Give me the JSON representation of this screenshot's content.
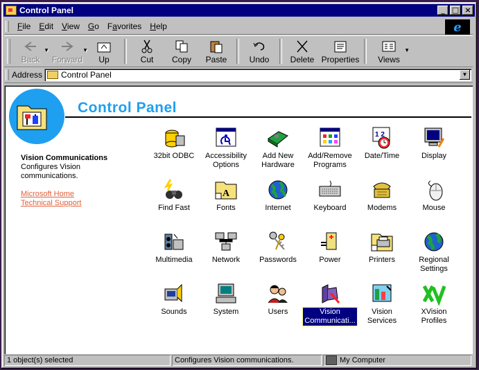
{
  "window": {
    "title": "Control Panel"
  },
  "menu": [
    "File",
    "Edit",
    "View",
    "Go",
    "Favorites",
    "Help"
  ],
  "menu_access_keys": [
    "F",
    "E",
    "V",
    "G",
    "a",
    "H"
  ],
  "toolbar": {
    "back": "Back",
    "forward": "Forward",
    "up": "Up",
    "cut": "Cut",
    "copy": "Copy",
    "paste": "Paste",
    "undo": "Undo",
    "delete": "Delete",
    "properties": "Properties",
    "views": "Views"
  },
  "address": {
    "label": "Address",
    "value": "Control Panel"
  },
  "banner": {
    "title": "Control Panel"
  },
  "info": {
    "title": "Vision Communications",
    "description": "Configures Vision communications.",
    "links": [
      "Microsoft Home",
      "Technical Support"
    ]
  },
  "items": [
    "32bit ODBC",
    "Accessibility\nOptions",
    "Add New\nHardware",
    "Add/Remove\nPrograms",
    "Date/Time",
    "Display",
    "Find Fast",
    "Fonts",
    "Internet",
    "Keyboard",
    "Modems",
    "Mouse",
    "Multimedia",
    "Network",
    "Passwords",
    "Power",
    "Printers",
    "Regional\nSettings",
    "Sounds",
    "System",
    "Users",
    "Vision\nCommunicati...",
    "Vision\nServices",
    "XVision\nProfiles"
  ],
  "selected_item": "Vision\nCommunicati...",
  "status": {
    "objects": "1 object(s) selected",
    "description": "Configures Vision communications.",
    "zone": "My Computer"
  },
  "colors": {
    "title_bar": "#000080",
    "banner_accent": "#1f9ff0",
    "link": "#e0603a",
    "face": "#c0c0c0"
  }
}
